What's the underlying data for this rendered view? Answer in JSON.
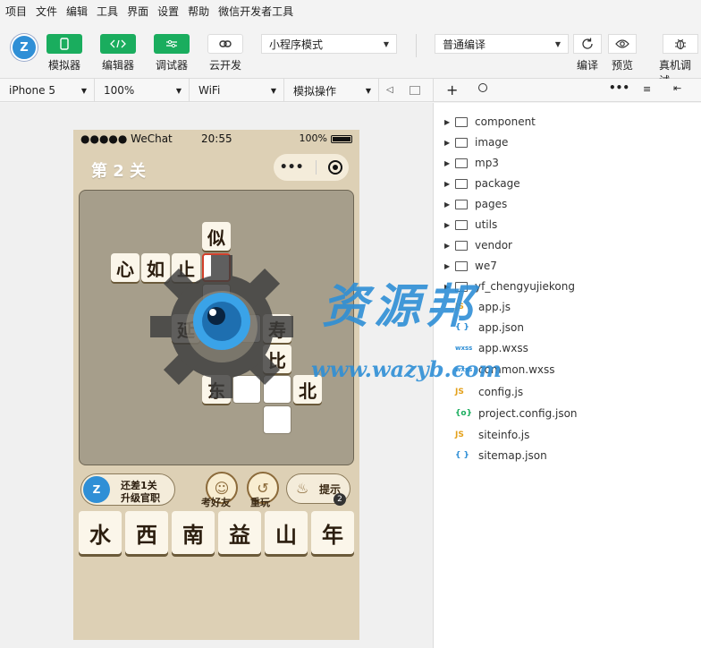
{
  "menu": [
    "项目",
    "文件",
    "编辑",
    "工具",
    "界面",
    "设置",
    "帮助",
    "微信开发者工具"
  ],
  "toolbar": {
    "simulator_label": "模拟器",
    "editor_label": "编辑器",
    "debugger_label": "调试器",
    "cloud_label": "云开发",
    "mode_select": "小程序模式",
    "compile_select": "普通编译",
    "compile_label": "编译",
    "preview_label": "预览",
    "device_debug_label": "真机调试"
  },
  "secondary": {
    "device": "iPhone 5",
    "zoom": "100%",
    "network": "WiFi",
    "action": "模拟操作"
  },
  "phone": {
    "status": {
      "signal": "●●●●● WeChat",
      "time": "20:55",
      "battery": "100%"
    },
    "level": "第 2 关",
    "board": {
      "c1": "似",
      "c2": "心",
      "c3": "如",
      "c4": "止",
      "c5": "延",
      "c6": "寿",
      "c7": "比",
      "c8": "东",
      "c9": "北"
    },
    "upgrade_line1": "还差1关",
    "upgrade_line2": "升级官职",
    "test_friend": "考好友",
    "replay": "重玩",
    "hint": "提示",
    "hint_count": "2",
    "choices": [
      "水",
      "西",
      "南",
      "益",
      "山",
      "年"
    ]
  },
  "watermark": {
    "text": "资源邦",
    "url": "www.wazyb.com"
  },
  "file_tree": {
    "folders": [
      "component",
      "image",
      "mp3",
      "package",
      "pages",
      "utils",
      "vendor",
      "we7",
      "yf_chengyujiekong"
    ],
    "files": [
      {
        "name": "app.js",
        "type": "JS"
      },
      {
        "name": "app.json",
        "type": "{ }"
      },
      {
        "name": "app.wxss",
        "type": "wxss"
      },
      {
        "name": "common.wxss",
        "type": "wxss"
      },
      {
        "name": "config.js",
        "type": "JS"
      },
      {
        "name": "project.config.json",
        "type": "{o}"
      },
      {
        "name": "siteinfo.js",
        "type": "JS"
      },
      {
        "name": "sitemap.json",
        "type": "{ }"
      }
    ]
  }
}
